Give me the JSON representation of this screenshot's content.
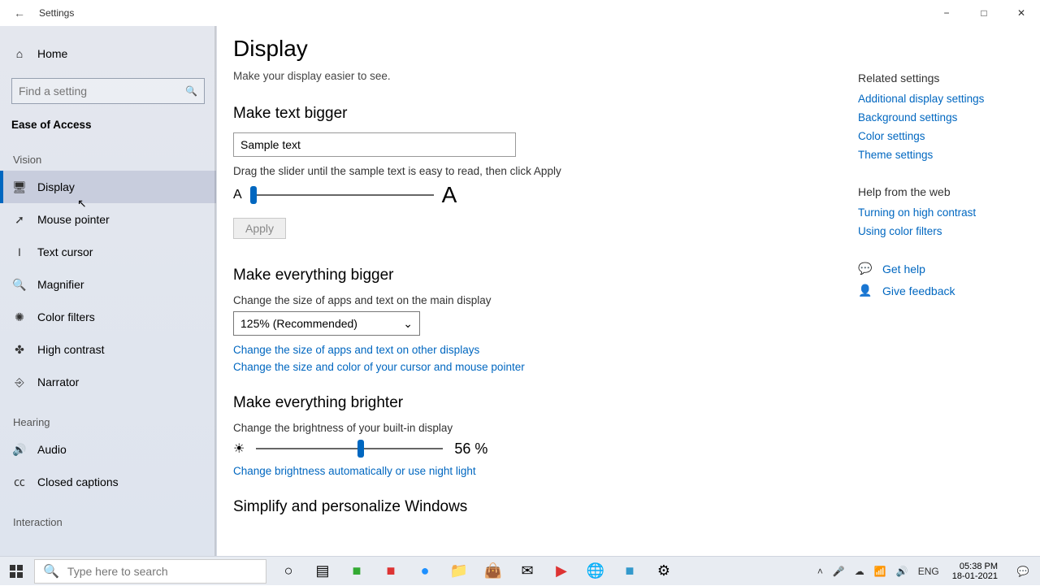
{
  "window": {
    "title": "Settings"
  },
  "sidebar": {
    "home": "Home",
    "search_placeholder": "Find a setting",
    "category": "Ease of Access",
    "groups": [
      {
        "label": "Vision",
        "items": [
          {
            "key": "display",
            "label": "Display",
            "active": true
          },
          {
            "key": "mouse-pointer",
            "label": "Mouse pointer"
          },
          {
            "key": "text-cursor",
            "label": "Text cursor"
          },
          {
            "key": "magnifier",
            "label": "Magnifier"
          },
          {
            "key": "color-filters",
            "label": "Color filters"
          },
          {
            "key": "high-contrast",
            "label": "High contrast"
          },
          {
            "key": "narrator",
            "label": "Narrator"
          }
        ]
      },
      {
        "label": "Hearing",
        "items": [
          {
            "key": "audio",
            "label": "Audio"
          },
          {
            "key": "closed-captions",
            "label": "Closed captions"
          }
        ]
      },
      {
        "label": "Interaction",
        "items": []
      }
    ]
  },
  "page": {
    "title": "Display",
    "subtitle": "Make your display easier to see.",
    "text_bigger": {
      "heading": "Make text bigger",
      "sample": "Sample text",
      "hint": "Drag the slider until the sample text is easy to read, then click Apply",
      "apply": "Apply",
      "slider_pos_pct": 2
    },
    "everything_bigger": {
      "heading": "Make everything bigger",
      "desc": "Change the size of apps and text on the main display",
      "selected": "125% (Recommended)",
      "link1": "Change the size of apps and text on other displays",
      "link2": "Change the size and color of your cursor and mouse pointer"
    },
    "brighter": {
      "heading": "Make everything brighter",
      "desc": "Change the brightness of your built-in display",
      "value_pct": 56,
      "value_label": "56 %",
      "link": "Change brightness automatically or use night light"
    },
    "simplify": {
      "heading": "Simplify and personalize Windows"
    }
  },
  "rail": {
    "related_heading": "Related settings",
    "related": [
      "Additional display settings",
      "Background settings",
      "Color settings",
      "Theme settings"
    ],
    "help_heading": "Help from the web",
    "help": [
      "Turning on high contrast",
      "Using color filters"
    ],
    "actions": {
      "get_help": "Get help",
      "give_feedback": "Give feedback"
    }
  },
  "taskbar": {
    "search_placeholder": "Type here to search",
    "lang": "ENG",
    "time": "05:38 PM",
    "date": "18-01-2021"
  }
}
